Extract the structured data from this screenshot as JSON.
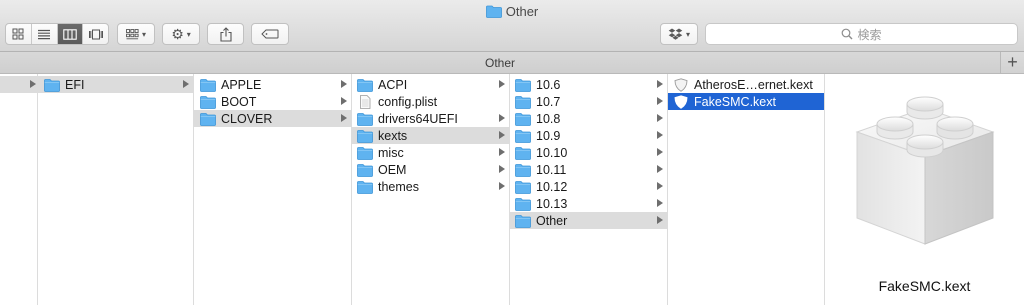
{
  "window": {
    "title": "Other"
  },
  "toolbar": {
    "view_buttons": [
      "icon-view",
      "list-view",
      "column-view",
      "cover-flow-view"
    ],
    "arrange_icon": "grid-arrange-icon",
    "action_icon": "gear-icon",
    "share_icon": "share-icon",
    "tag_icon": "tag-icon",
    "dropbox_icon": "dropbox-icon",
    "search_placeholder": "検索"
  },
  "tab": {
    "label": "Other",
    "add_label": "+"
  },
  "columns": {
    "col1": [
      {
        "label": "EFI",
        "selected": true
      }
    ],
    "col2": [
      {
        "label": "APPLE"
      },
      {
        "label": "BOOT"
      },
      {
        "label": "CLOVER",
        "selected": true
      }
    ],
    "col3": [
      {
        "label": "ACPI"
      },
      {
        "label": "config.plist",
        "file": true
      },
      {
        "label": "drivers64UEFI"
      },
      {
        "label": "kexts",
        "selected": true
      },
      {
        "label": "misc"
      },
      {
        "label": "OEM"
      },
      {
        "label": "themes"
      }
    ],
    "col4": [
      {
        "label": "10.6"
      },
      {
        "label": "10.7"
      },
      {
        "label": "10.8"
      },
      {
        "label": "10.9"
      },
      {
        "label": "10.10"
      },
      {
        "label": "10.11"
      },
      {
        "label": "10.12"
      },
      {
        "label": "10.13"
      },
      {
        "label": "Other",
        "selected": true
      }
    ],
    "col5": [
      {
        "label": "AtherosE…ernet.kext"
      },
      {
        "label": "FakeSMC.kext",
        "selected": true
      }
    ]
  },
  "preview": {
    "name": "FakeSMC.kext",
    "icon": "kext-lego-brick-icon"
  },
  "colors": {
    "selection_blue": "#1f64d4",
    "folder_blue": "#5fb3f0"
  }
}
